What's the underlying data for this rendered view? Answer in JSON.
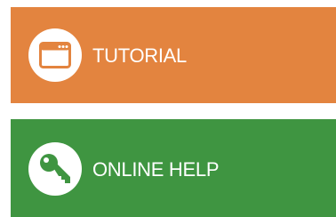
{
  "tiles": [
    {
      "label": "TUTORIAL",
      "icon": "browser-window-icon",
      "color": "#E3843F"
    },
    {
      "label": "ONLINE HELP",
      "icon": "key-icon",
      "color": "#3F9541"
    }
  ],
  "colors": {
    "page_background": "#FFFFFF",
    "icon_circle": "#FFFFFF",
    "label_text": "#FFFFFF"
  }
}
